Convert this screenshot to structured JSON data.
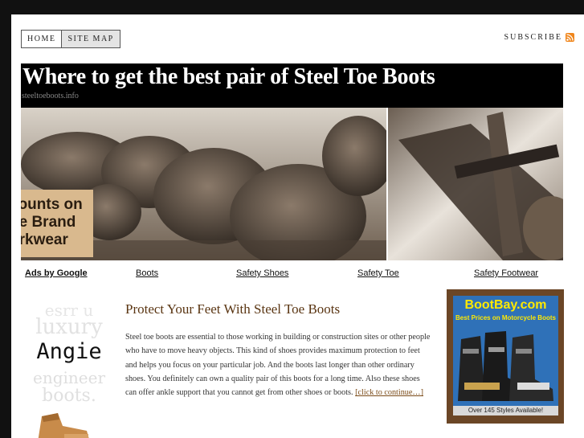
{
  "nav": {
    "tabs": [
      {
        "label": "HOME"
      },
      {
        "label": "SITE MAP"
      }
    ],
    "subscribe_label": "SUBSCRIBE",
    "rss_icon": "rss-feed-icon"
  },
  "header": {
    "title": "Where to get the best pair of Steel Toe Boots",
    "domain": "steeltoeboots.info"
  },
  "banner": {
    "promo_lines": [
      "counts on",
      "ne Brand",
      "orkwear"
    ]
  },
  "ad_links": {
    "ads_label": "Ads by Google",
    "links": [
      "Boots",
      "Safety Shoes",
      "Safety Toe",
      "Safety Footwear"
    ]
  },
  "thumb": {
    "lines": [
      "esrr u",
      "luxury",
      "Angie",
      "engineer",
      "boots."
    ]
  },
  "article": {
    "title": "Protect Your Feet With Steel Toe Boots",
    "body": "Steel toe boots are essential to those working in building or construction sites or other people who have to move heavy objects. This kind of shoes provides maximum protection to feet and helps you focus on your particular job. And the boots last longer than other ordinary shoes. You definitely can own a quality pair of this boots for a long time. Also these shoes can offer ankle support that you cannot get from other shoes or boots.",
    "more_link": "[click to continue…]"
  },
  "sidebar_ad": {
    "brand": "BootBay.com",
    "tagline": "Best Prices on Motorcycle Boots",
    "footer": "Over 145 Styles Available!",
    "colors": {
      "frame": "#6b4626",
      "panel": "#2f71b8",
      "text": "#ffe900"
    }
  }
}
